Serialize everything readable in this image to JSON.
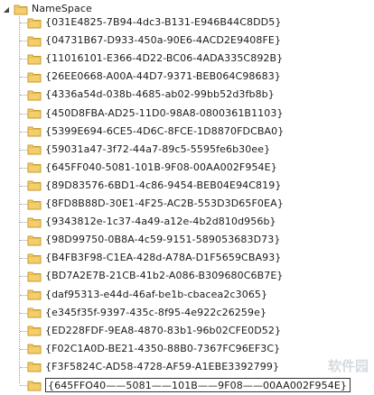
{
  "root": {
    "label": "NameSpace",
    "expander": "expanded-triangle-icon"
  },
  "children": [
    "{031E4825-7B94-4dc3-B131-E946B44C8DD5}",
    "{04731B67-D933-450a-90E6-4ACD2E9408FE}",
    "{11016101-E366-4D22-BC06-4ADA335C892B}",
    "{26EE0668-A00A-44D7-9371-BEB064C98683}",
    "{4336a54d-038b-4685-ab02-99bb52d3fb8b}",
    "{450D8FBA-AD25-11D0-98A8-0800361B1103}",
    "{5399E694-6CE5-4D6C-8FCE-1D8870FDCBA0}",
    "{59031a47-3f72-44a7-89c5-5595fe6b30ee}",
    "{645FF040-5081-101B-9F08-00AA002F954E}",
    "{89D83576-6BD1-4c86-9454-BEB04E94C819}",
    "{8FD8B88D-30E1-4F25-AC2B-553D3D65F0EA}",
    "{9343812e-1c37-4a49-a12e-4b2d810d956b}",
    "{98D99750-0B8A-4c59-9151-589053683D73}",
    "{B4FB3F98-C1EA-428d-A78A-D1F5659CBA93}",
    "{BD7A2E7B-21CB-41b2-A086-B309680C6B7E}",
    "{daf95313-e44d-46af-be1b-cbacea2c3065}",
    "{e345f35f-9397-435c-8f95-4e922c26259e}",
    "{ED228FDF-9EA8-4870-83b1-96b02CFE0D52}",
    "{F02C1A0D-BE21-4350-88B0-7367FC96EF3C}",
    "{F3F5824C-AD58-4728-AF59-A1EBE3392799}"
  ],
  "editing": {
    "value": "{645FFO40——5081——101B——9F08——00AA002F954E}"
  },
  "watermark": "软件园",
  "colors": {
    "folder_fill": "#f2cf6a",
    "folder_edge": "#c79a2e",
    "folder_tab": "#e6b84a"
  }
}
